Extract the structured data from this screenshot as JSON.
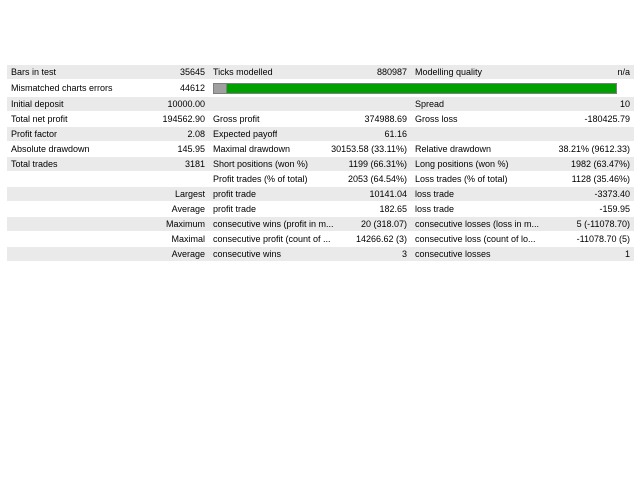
{
  "colors": {
    "stripe": "#eaeaea",
    "quality_green": "#00a000",
    "quality_gray": "#a0a0a0"
  },
  "modelling_quality_fill": 0.03,
  "rows": {
    "r1": {
      "l1": "Bars in test",
      "v1": "35645",
      "l2": "Ticks modelled",
      "v2": "880987",
      "l3": "Modelling quality",
      "v3": "n/a"
    },
    "r2": {
      "l1": "Mismatched charts errors",
      "v1": "44612"
    },
    "r3": {
      "l1": "Initial deposit",
      "v1": "10000.00",
      "l3": "Spread",
      "v3": "10"
    },
    "r4": {
      "l1": "Total net profit",
      "v1": "194562.90",
      "l2": "Gross profit",
      "v2": "374988.69",
      "l3": "Gross loss",
      "v3": "-180425.79"
    },
    "r5": {
      "l1": "Profit factor",
      "v1": "2.08",
      "l2": "Expected payoff",
      "v2": "61.16"
    },
    "r6": {
      "l1": "Absolute drawdown",
      "v1": "145.95",
      "l2": "Maximal drawdown",
      "v2": "30153.58 (33.11%)",
      "l3": "Relative drawdown",
      "v3": "38.21% (9612.33)"
    },
    "r7": {
      "l1": "Total trades",
      "v1": "3181",
      "l2": "Short positions (won %)",
      "v2": "1199 (66.31%)",
      "l3": "Long positions (won %)",
      "v3": "1982 (63.47%)"
    },
    "r8": {
      "l2": "Profit trades (% of total)",
      "v2": "2053 (64.54%)",
      "l3": "Loss trades (% of total)",
      "v3": "1128 (35.46%)"
    },
    "r9": {
      "v1": "Largest",
      "l2": "profit trade",
      "v2": "10141.04",
      "l3": "loss trade",
      "v3": "-3373.40"
    },
    "r10": {
      "v1": "Average",
      "l2": "profit trade",
      "v2": "182.65",
      "l3": "loss trade",
      "v3": "-159.95"
    },
    "r11": {
      "v1": "Maximum",
      "l2": "consecutive wins (profit in m...",
      "v2": "20 (318.07)",
      "l3": "consecutive losses (loss in m...",
      "v3": "5 (-11078.70)"
    },
    "r12": {
      "v1": "Maximal",
      "l2": "consecutive profit (count of ...",
      "v2": "14266.62 (3)",
      "l3": "consecutive loss (count of lo...",
      "v3": "-11078.70 (5)"
    },
    "r13": {
      "v1": "Average",
      "l2": "consecutive wins",
      "v2": "3",
      "l3": "consecutive losses",
      "v3": "1"
    }
  }
}
